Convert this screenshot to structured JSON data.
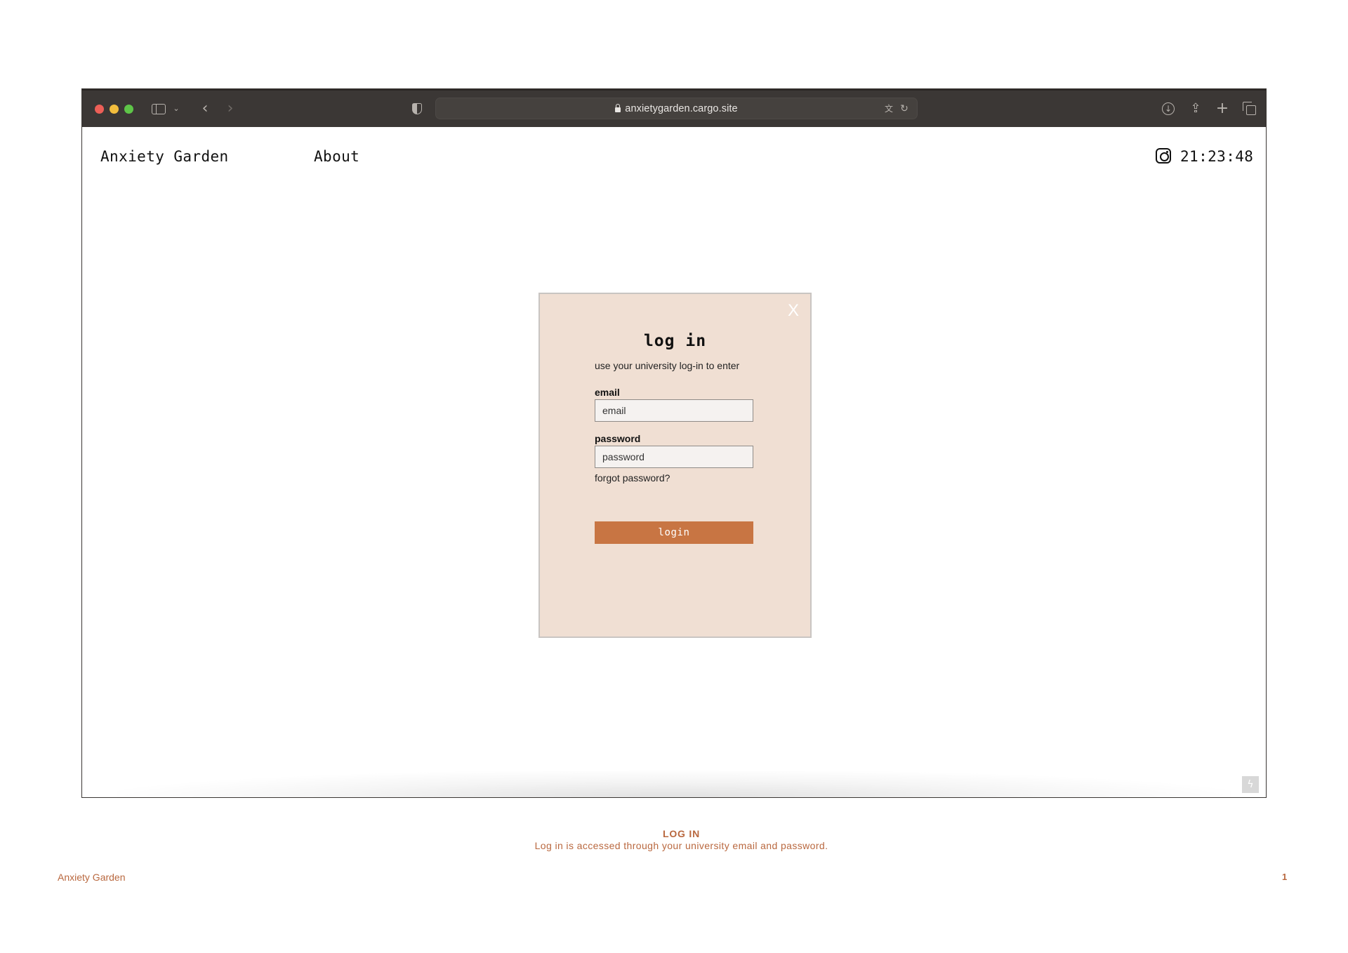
{
  "browser": {
    "address": "anxietygarden.cargo.site",
    "icons": [
      "sidebar-icon",
      "chevron-down-icon",
      "back-arrow-icon",
      "forward-arrow-icon",
      "shield-icon",
      "lock-icon",
      "translate-icon",
      "reload-icon",
      "download-icon",
      "share-icon",
      "new-tab-icon",
      "tabs-overview-icon"
    ]
  },
  "site": {
    "title": "Anxiety Garden",
    "nav_about": "About",
    "clock": "21:23:48"
  },
  "modal": {
    "close": "X",
    "title": "log in",
    "subtitle": "use your university log-in to enter",
    "email_label": "email",
    "email_placeholder": "email",
    "password_label": "password",
    "password_placeholder": "password",
    "forgot": "forgot password?",
    "login_button": "login"
  },
  "caption": {
    "title": "LOG IN",
    "text": "Log in is accessed through your university email and password."
  },
  "footer": {
    "left": "Anxiety Garden",
    "page_number": "1"
  },
  "colors": {
    "modal_bg": "#f0dfd3",
    "accent": "#c87543",
    "caption": "#b9683f",
    "toolbar": "#3b3735"
  }
}
